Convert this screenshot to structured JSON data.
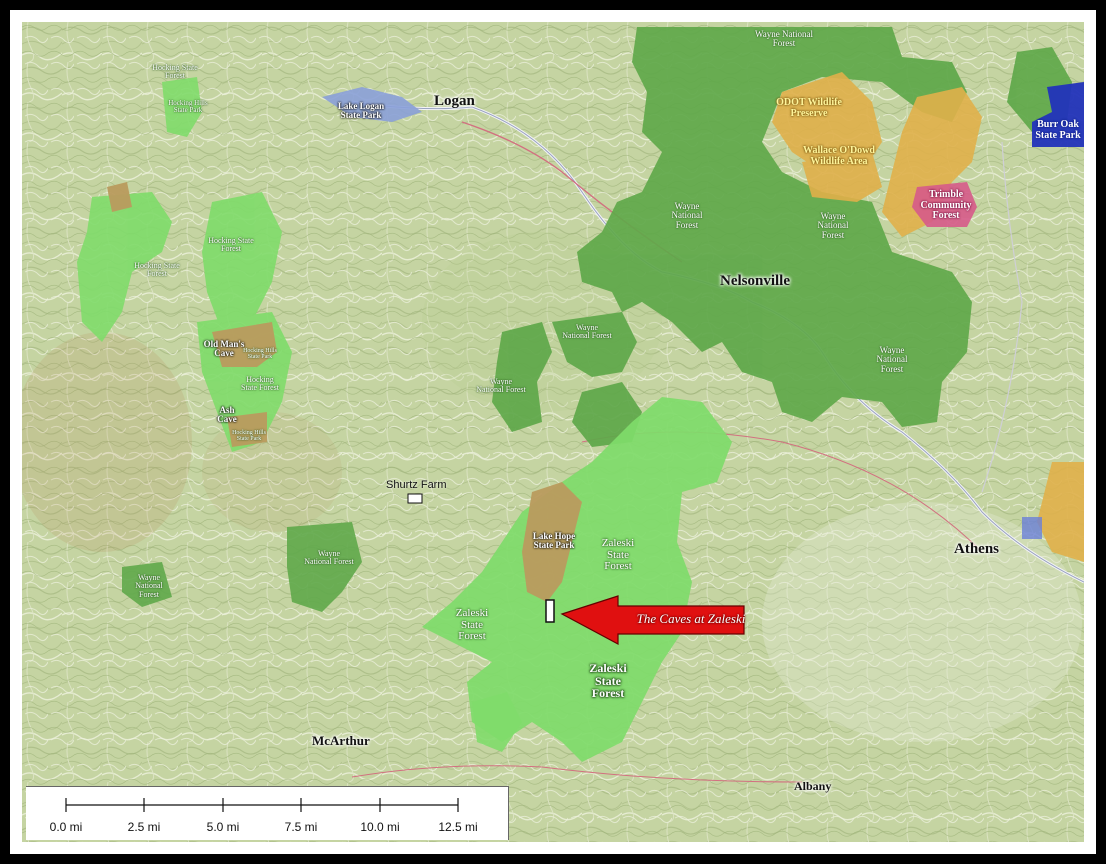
{
  "map": {
    "towns": {
      "logan": "Logan",
      "nelsonville": "Nelsonville",
      "athens": "Athens",
      "mcarthur": "McArthur",
      "albany": "Albany"
    },
    "areas": {
      "hocking_sf_1": "Hocking State Forest",
      "hocking_hills_sp_1": "Hocking Hills State Park",
      "lake_logan": "Lake Logan State Park",
      "hocking_sf_2": "Hocking State Forest",
      "hocking_sf_3": "Hocking State Forest",
      "old_mans_cave": "Old Man's Cave",
      "hocking_hills_sp_2": "Hocking Hills State Park",
      "hocking_sf_4": "Hocking State Forest",
      "ash_cave": "Ash Cave",
      "hocking_hills_sp_3": "Hocking Hills State Park",
      "wayne_nf_top": "Wayne National Forest",
      "odot": "ODOT Wildlife Preserve",
      "wallace": "Wallace O'Dowd Wildlife Area",
      "trimble": "Trimble Community Forest",
      "burr_oak": "Burr Oak State Park",
      "wayne_nf_2": "Wayne National Forest",
      "wayne_nf_3": "Wayne National Forest",
      "wayne_nf_4": "Wayne National Forest",
      "wayne_nf_5": "Wayne National Forest",
      "wayne_nf_6": "Wayne National Forest",
      "wayne_nf_7": "Wayne National Forest",
      "wayne_nf_8": "Wayne National Forest",
      "lake_hope": "Lake Hope State Park",
      "zaleski_1": "Zaleski State Forest",
      "zaleski_2": "Zaleski State Forest",
      "zaleski_3": "Zaleski State Forest",
      "shurtz_farm": "Shurtz Farm"
    },
    "callout": "The Caves at Zaleski",
    "colors": {
      "base": "#c9d7a8",
      "state_forest": "#7fdc6a",
      "national_forest": "#5fa84a",
      "state_park": "#b99b5e",
      "wildlife": "#e0b04a",
      "community_forest": "#d65a8a",
      "burr_oak": "#2233bb",
      "arrow": "#e01010"
    }
  },
  "scale": {
    "ticks": [
      "0.0 mi",
      "2.5 mi",
      "5.0 mi",
      "7.5 mi",
      "10.0 mi",
      "12.5 mi"
    ]
  }
}
